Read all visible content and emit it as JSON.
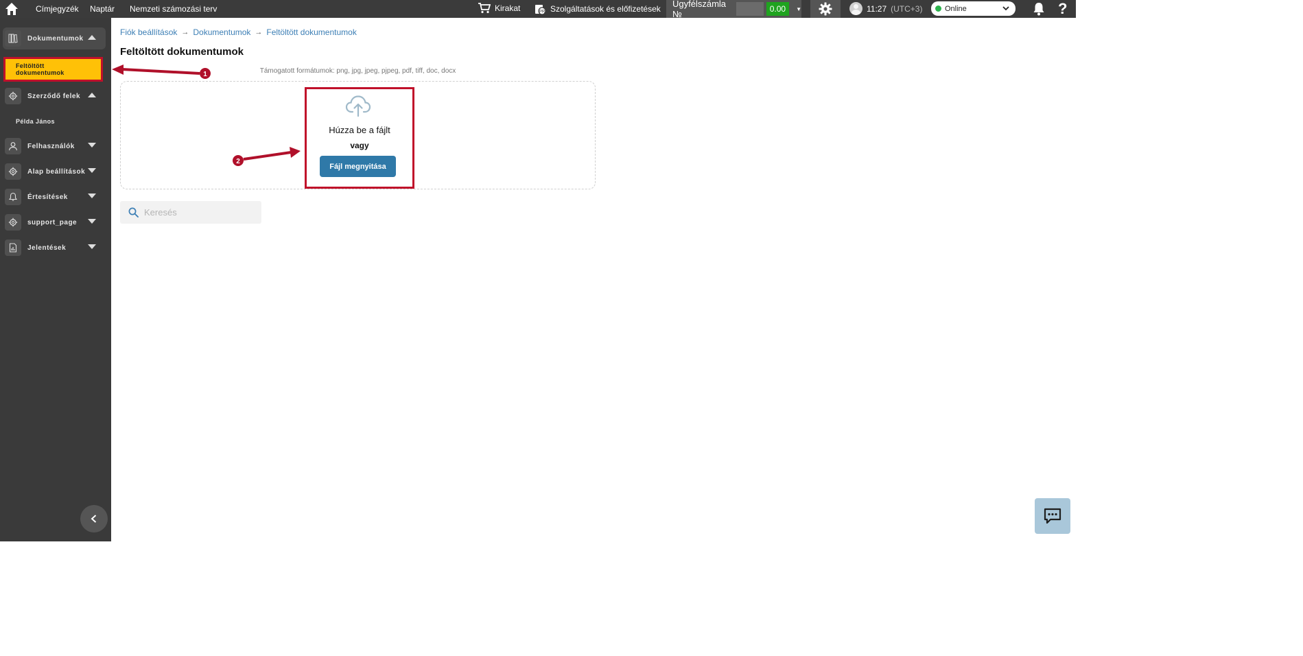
{
  "topbar": {
    "nav_items": [
      "Címjegyzék",
      "Naptár",
      "Nemzeti számozási terv"
    ],
    "shop_label": "Kirakat",
    "services_label": "Szolgáltatások és előfizetések",
    "account_label": "Ügyfélszámla №",
    "balance": "0.00",
    "time": "11:27",
    "timezone": "(UTC+3)",
    "status": "Online"
  },
  "sidebar": {
    "documents": "Dokumentumok",
    "uploaded_line1": "Feltöltött",
    "uploaded_line2": "dokumentumok",
    "contract_parties": "Szerződő felek",
    "sample_party": "Példa János",
    "users": "Felhasználók",
    "basic_settings": "Alap beállítások",
    "notifications": "Értesítések",
    "support_page": "support_page",
    "reports": "Jelentések"
  },
  "breadcrumb": {
    "item1": "Fiók beállítások",
    "item2": "Dokumentumok",
    "item3": "Feltöltött dokumentumok"
  },
  "main": {
    "title": "Feltöltött dokumentumok",
    "formats": "Támogatott formátumok: png, jpg, jpeg, pjpeg, pdf, tiff, doc, docx",
    "drop_text": "Húzza be a fájlt",
    "or_text": "vagy",
    "open_button": "Fájl megnyitása",
    "search_placeholder": "Keresés"
  },
  "annotations": {
    "step1": "1",
    "step2": "2"
  },
  "colors": {
    "accent": "#2f79a8",
    "active_item": "#ffc107",
    "highlight": "#c0102a",
    "sidebar_bg": "#3a3a3a",
    "balance": "#1fa31f"
  }
}
